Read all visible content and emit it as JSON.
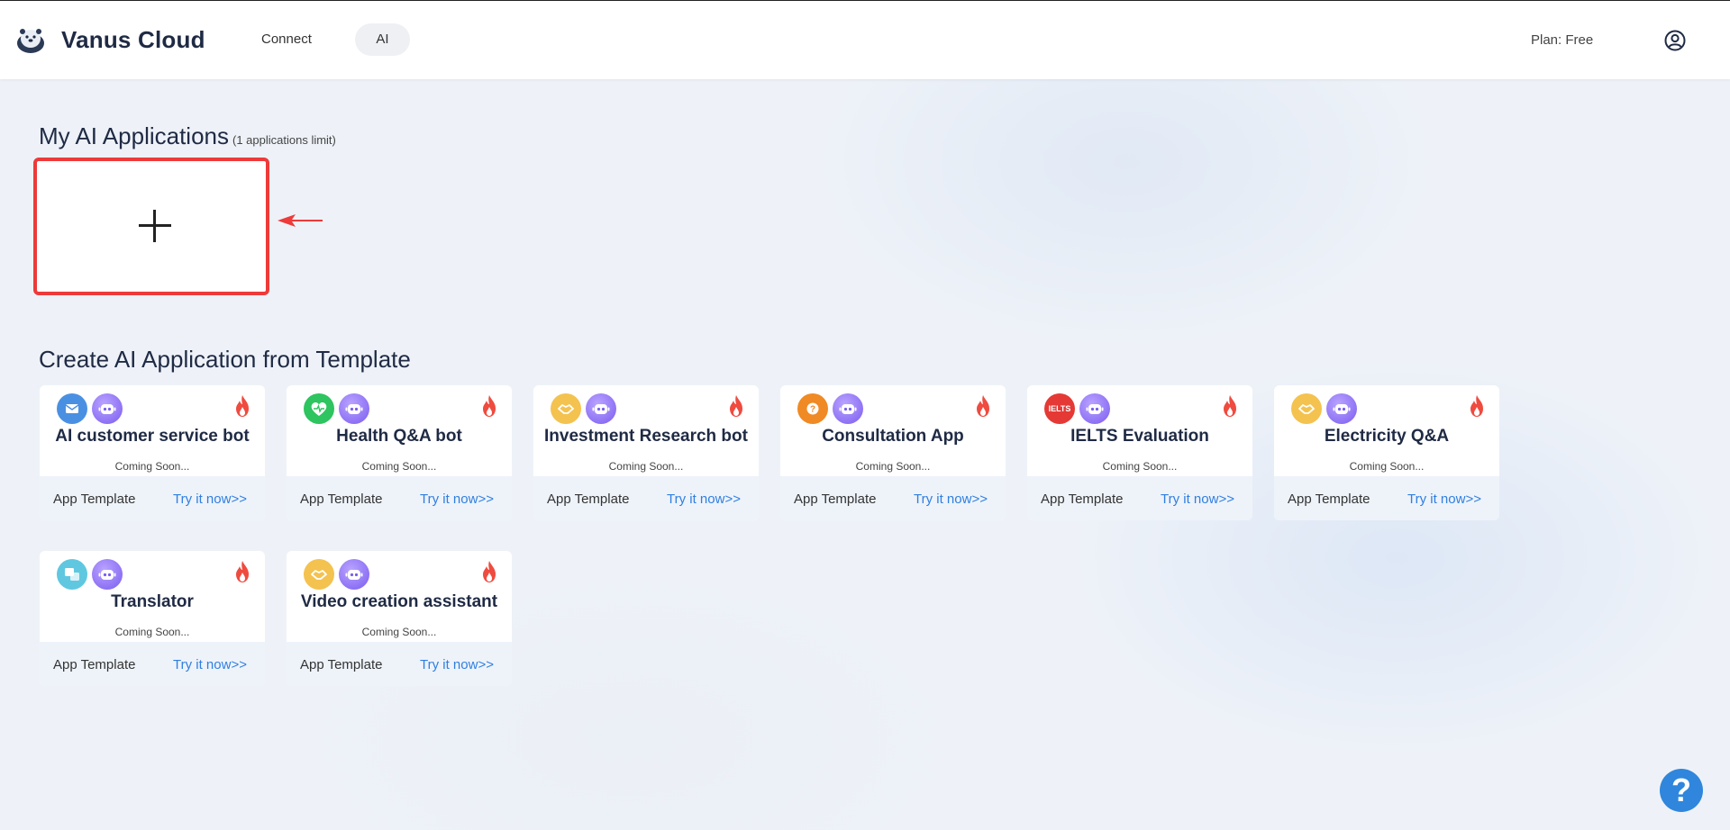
{
  "header": {
    "brand": "Vanus Cloud",
    "nav": {
      "connect": "Connect",
      "ai": "AI"
    },
    "plan": "Plan: Free"
  },
  "my_apps": {
    "title": "My AI Applications",
    "limit": "(1 applications limit)"
  },
  "templates": {
    "title": "Create AI Application from Template",
    "footer_label": "App Template",
    "try_label": "Try it now>>",
    "coming_soon": "Coming Soon...",
    "items": [
      {
        "name": "AI customer service bot",
        "icon": "mail-icon",
        "color": "#4a90e2"
      },
      {
        "name": "Health Q&A bot",
        "icon": "heart-pulse-icon",
        "color": "#2ec45f"
      },
      {
        "name": "Investment Research bot",
        "icon": "handshake-icon",
        "color": "#f4c24f"
      },
      {
        "name": "Consultation App",
        "icon": "question-icon",
        "color": "#f08a24"
      },
      {
        "name": "IELTS Evaluation",
        "icon": "ielts-icon",
        "color": "#e53935"
      },
      {
        "name": "Electricity Q&A",
        "icon": "handshake-icon",
        "color": "#f4c24f"
      },
      {
        "name": "Translator",
        "icon": "translate-icon",
        "color": "#5fc8e0"
      },
      {
        "name": "Video creation assistant",
        "icon": "handshake-icon",
        "color": "#f4c24f"
      }
    ]
  },
  "ielts_badge": "IELTS",
  "help": "?"
}
